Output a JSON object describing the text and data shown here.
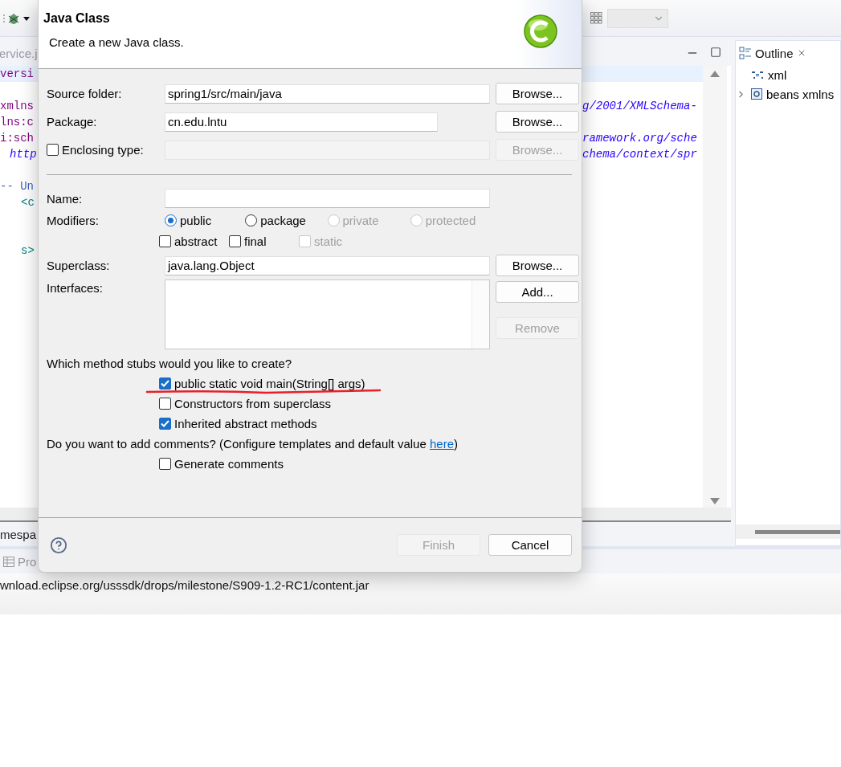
{
  "ide": {
    "editor_tab": "ervice.j",
    "code_lines": [
      {
        "left": {
          "text": "versi",
          "kind": "attr"
        },
        "highlighted": true
      },
      {
        "left": {
          "text": "xmlns",
          "kind": "attr"
        },
        "right": {
          "text": "g/2001/XMLSchema-",
          "kind": "string"
        },
        "gap_before": true
      },
      {
        "left": {
          "text": "lns:c",
          "kind": "attr"
        }
      },
      {
        "left": {
          "text": "i:sch",
          "kind": "attr"
        },
        "right": {
          "text": "ramework.org/sche",
          "kind": "string"
        }
      },
      {
        "left": {
          "text": "http",
          "kind": "string"
        },
        "right": {
          "text": "chema/context/spr",
          "kind": "string"
        }
      },
      {
        "left": {
          "text": "-- Un",
          "kind": "comment"
        },
        "gap_before": true
      },
      {
        "left": {
          "text": "<c",
          "kind": "tag"
        }
      },
      {
        "left": {
          "text": "s>",
          "kind": "tag"
        },
        "wide_gap_before": true
      }
    ],
    "bottom_tab": "mespa",
    "problems_tab": "Pro",
    "status": "wnload.eclipse.org/usssdk/drops/milestone/S909-1.2-RC1/content.jar",
    "outline": {
      "title": "Outline",
      "items": [
        {
          "label": "xml",
          "kind": "instruction",
          "expandable": false
        },
        {
          "label": "beans xmlns",
          "kind": "element",
          "expandable": true
        }
      ]
    }
  },
  "dialog": {
    "title": "Java Class",
    "subtitle": "Create a new Java class.",
    "fields": [
      {
        "label": "Source folder:",
        "value": "spring1/src/main/java",
        "button": "Browse...",
        "disabled": false,
        "kind": "text"
      },
      {
        "label": "Package:",
        "value": "cn.edu.lntu",
        "button": "Browse...",
        "disabled": false,
        "kind": "short"
      },
      {
        "label": "Enclosing type:",
        "button": "Browse...",
        "disabled": true,
        "kind": "checkbox",
        "checked": false
      }
    ],
    "name_label": "Name:",
    "modifiers_label": "Modifiers:",
    "visibility": [
      {
        "label": "public",
        "selected": true,
        "disabled": false
      },
      {
        "label": "package",
        "selected": false,
        "disabled": false
      },
      {
        "label": "private",
        "selected": false,
        "disabled": true
      },
      {
        "label": "protected",
        "selected": false,
        "disabled": true
      }
    ],
    "flags": [
      {
        "label": "abstract",
        "checked": false,
        "disabled": false
      },
      {
        "label": "final",
        "checked": false,
        "disabled": false
      },
      {
        "label": "static",
        "checked": false,
        "disabled": true
      }
    ],
    "superclass": {
      "label": "Superclass:",
      "value": "java.lang.Object",
      "button": "Browse..."
    },
    "interfaces": {
      "label": "Interfaces:",
      "buttons": [
        {
          "label": "Add...",
          "disabled": false
        },
        {
          "label": "Remove",
          "disabled": true
        }
      ]
    },
    "stubs_question": "Which method stubs would you like to create?",
    "stubs": [
      {
        "label": "public static void main(String[] args)",
        "checked": true,
        "underlined": true
      },
      {
        "label": "Constructors from superclass",
        "checked": false,
        "underlined": false
      },
      {
        "label": "Inherited abstract methods",
        "checked": true,
        "underlined": false
      }
    ],
    "comments_question": "Do you want to add comments? (Configure templates and default value ",
    "comments_link": "here",
    "comments_end": ")",
    "comments": [
      {
        "label": "Generate comments",
        "checked": false
      }
    ],
    "footer_buttons": [
      {
        "label": "Finish",
        "disabled": true
      },
      {
        "label": "Cancel",
        "disabled": false
      }
    ]
  }
}
